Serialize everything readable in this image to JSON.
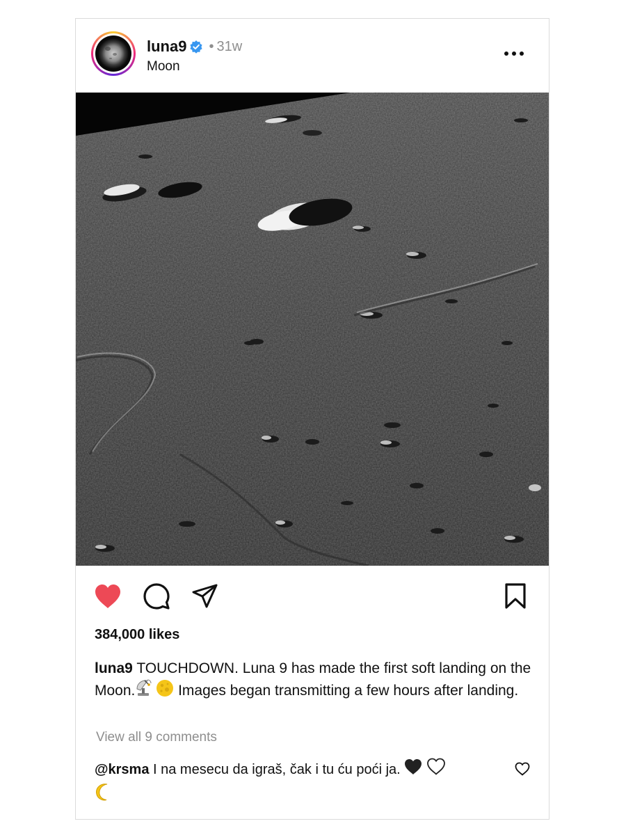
{
  "post": {
    "username": "luna9",
    "verified": true,
    "separator": "•",
    "time_ago": "31w",
    "location": "Moon",
    "more_icon": "more-horizontal-icon",
    "image_subject": "lunar surface with craters",
    "likes_text": "384,000 likes",
    "liked": true,
    "colors": {
      "like": "#ed4956",
      "verified": "#3897f0",
      "muted": "#8e8e8e",
      "border": "#dbdbdb"
    }
  },
  "caption": {
    "username": "luna9",
    "text_part1": "TOUCHDOWN. Luna 9 has made the first soft landing on the Moon.",
    "emojis": [
      "satellite-antenna-icon",
      "full-moon-icon"
    ],
    "text_part2": "Images began transmitting a few hours after landing."
  },
  "comments": {
    "view_all_label": "View all 9 comments",
    "items": [
      {
        "username": "@krsma",
        "text": "I na mesecu da igraš, čak i tu ću poći ja.",
        "emojis": [
          "black-heart-icon",
          "white-heart-icon",
          "crescent-moon-icon"
        ]
      }
    ]
  }
}
